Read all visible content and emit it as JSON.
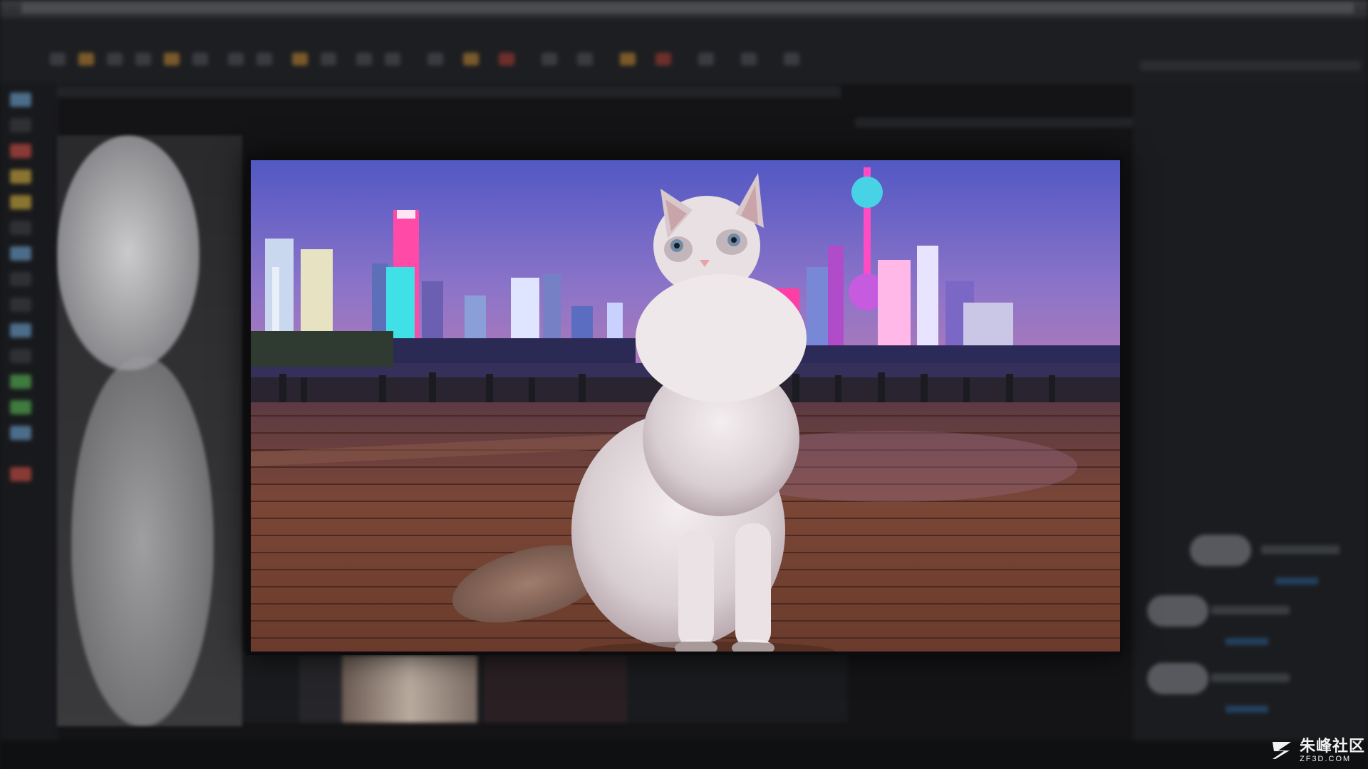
{
  "watermark": {
    "title": "朱峰社区",
    "subtitle": "ZF3D.COM"
  },
  "viewer": {
    "content": "composited-cat-on-night-promenade"
  },
  "colors": {
    "sky_top": "#5a63c9",
    "sky_bottom": "#9a78c6",
    "deck": "#7a4636",
    "neon_pink": "#ff3ea5",
    "neon_cyan": "#3fe0e6",
    "panel_bg": "#1d1e21"
  },
  "icons": {
    "watermark_logo": "zf-logo-icon"
  }
}
